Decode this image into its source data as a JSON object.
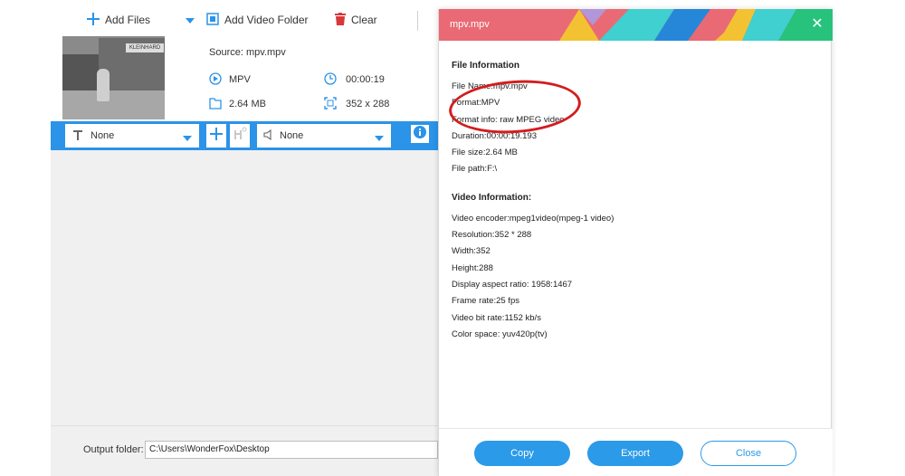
{
  "toolbar": {
    "add_files": "Add Files",
    "add_video_folder": "Add Video Folder",
    "clear": "Clear"
  },
  "file": {
    "source": "Source: mpv.mpv",
    "format": "MPV",
    "duration": "00:00:19",
    "size": "2.64 MB",
    "resolution": "352 x 288",
    "thumb_sign": "KLEINHARD"
  },
  "options": {
    "subtitle": "None",
    "audio": "None"
  },
  "footer": {
    "output_label": "Output folder:",
    "output_path": "C:\\Users\\WonderFox\\Desktop"
  },
  "dialog": {
    "title": "mpv.mpv",
    "file_info_title": "File Information",
    "file_info": [
      "File Name:mpv.mpv",
      "Format:MPV",
      "Format info: raw MPEG video",
      "Duration:00:00:19.193",
      "File size:2.64 MB",
      "File path:F:\\"
    ],
    "video_info_title": "Video Information:",
    "video_info": [
      "Video encoder:mpeg1video(mpeg-1 video)",
      "Resolution:352 * 288",
      "Width:352",
      "Height:288",
      "Display aspect ratio: 1958:1467",
      "Frame rate:25 fps",
      "Video bit rate:1152 kb/s",
      "Color space: yuv420p(tv)"
    ],
    "copy": "Copy",
    "export": "Export",
    "close": "Close"
  },
  "colors": {
    "accent": "#2b93e8",
    "header_pink": "#e96a74",
    "annotation": "#d21d20"
  }
}
